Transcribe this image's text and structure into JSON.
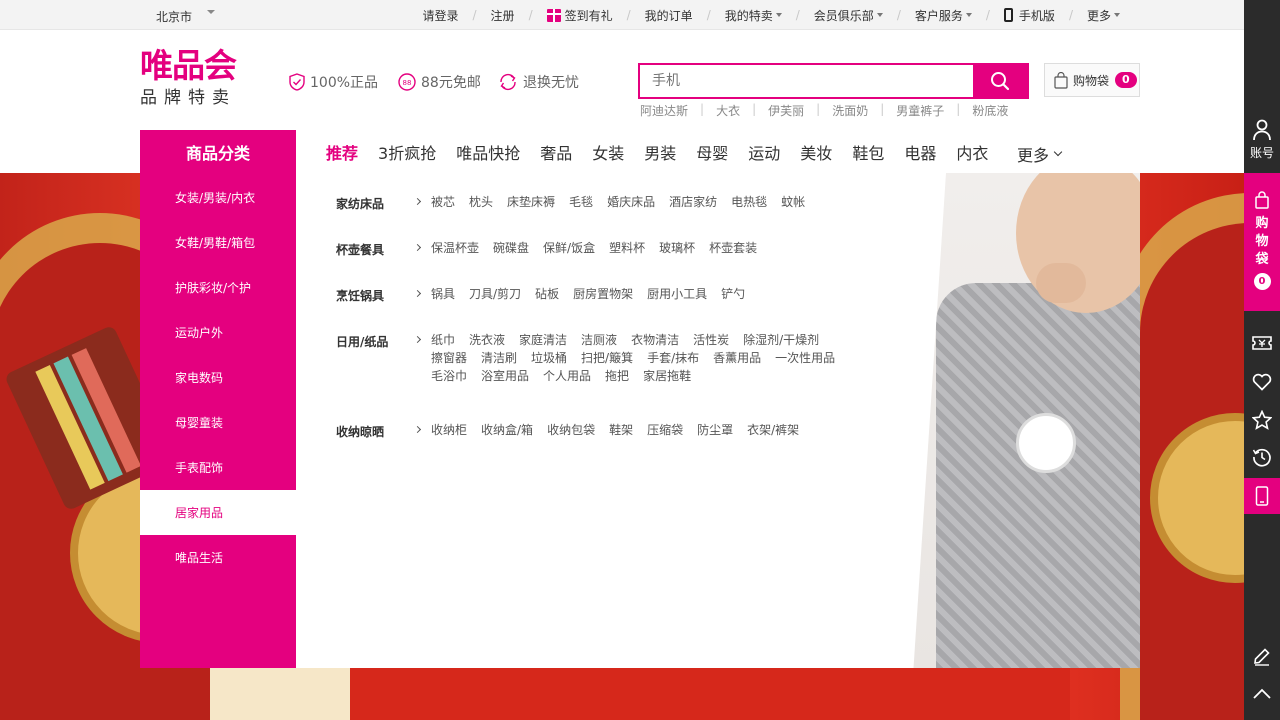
{
  "topbar": {
    "city": "北京市",
    "links": [
      {
        "label": "请登录"
      },
      {
        "label": "注册"
      },
      {
        "label": "签到有礼"
      },
      {
        "label": "我的订单"
      },
      {
        "label": "我的特卖"
      },
      {
        "label": "会员俱乐部"
      },
      {
        "label": "客户服务"
      },
      {
        "label": "手机版"
      },
      {
        "label": "更多"
      }
    ]
  },
  "header": {
    "logo_main": "唯品会",
    "logo_sub": "品牌特卖",
    "promises": [
      "100%正品",
      "88元免邮",
      "退换无忧"
    ],
    "search_placeholder": "手机",
    "hotwords": [
      "阿迪达斯",
      "大衣",
      "伊芙丽",
      "洗面奶",
      "男童裤子",
      "粉底液"
    ],
    "cart_label": "购物袋",
    "cart_count": "0"
  },
  "nav": {
    "category_title": "商品分类",
    "items": [
      "推荐",
      "3折疯抢",
      "唯品快抢",
      "奢品",
      "女装",
      "男装",
      "母婴",
      "运动",
      "美妆",
      "鞋包",
      "电器",
      "内衣"
    ],
    "more": "更多"
  },
  "categories": [
    "女装/男装/内衣",
    "女鞋/男鞋/箱包",
    "护肤彩妆/个护",
    "运动户外",
    "家电数码",
    "母婴童装",
    "手表配饰",
    "居家用品",
    "唯品生活"
  ],
  "panel_groups": [
    {
      "name": "家纺床品",
      "items": [
        "被芯",
        "枕头",
        "床垫床褥",
        "毛毯",
        "婚庆床品",
        "酒店家纺",
        "电热毯",
        "蚊帐"
      ]
    },
    {
      "name": "杯壶餐具",
      "items": [
        "保温杯壶",
        "碗碟盘",
        "保鲜/饭盒",
        "塑料杯",
        "玻璃杯",
        "杯壶套装"
      ]
    },
    {
      "name": "烹饪锅具",
      "items": [
        "锅具",
        "刀具/剪刀",
        "砧板",
        "厨房置物架",
        "厨用小工具",
        "铲勺"
      ]
    },
    {
      "name": "日用/纸品",
      "items": [
        "纸巾",
        "洗衣液",
        "家庭清洁",
        "洁厕液",
        "衣物清洁",
        "活性炭",
        "除湿剂/干燥剂",
        "擦窗器",
        "清洁刷",
        "垃圾桶",
        "扫把/簸箕",
        "手套/抹布",
        "香薰用品",
        "一次性用品",
        "毛浴巾",
        "浴室用品",
        "个人用品",
        "拖把",
        "家居拖鞋"
      ]
    },
    {
      "name": "收纳晾晒",
      "items": [
        "收纳柜",
        "收纳盒/箱",
        "收纳包袋",
        "鞋架",
        "压缩袋",
        "防尘罩",
        "衣架/裤架"
      ]
    }
  ],
  "sidebar_right": {
    "account": "账号",
    "cart": "购物袋",
    "cart_count": "0"
  },
  "colors": {
    "brand": "#e4007f",
    "toolbar": "#2b2b2b"
  }
}
